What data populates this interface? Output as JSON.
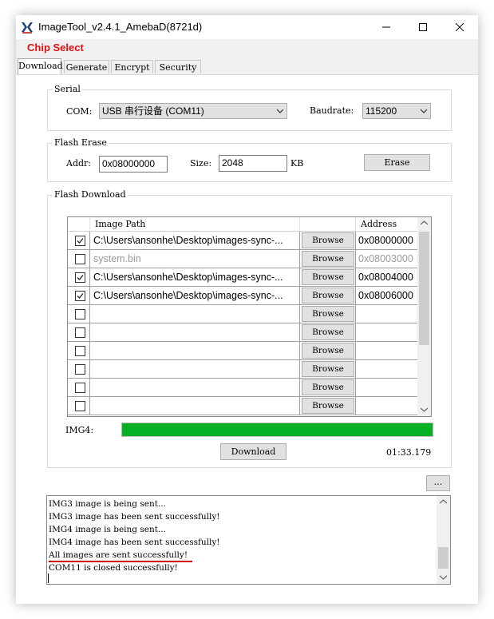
{
  "window": {
    "title": "ImageTool_v2.4.1_AmebaD(8721d)",
    "icon": "realtek-logo-icon"
  },
  "menu": {
    "chip_select": "Chip Select"
  },
  "tabs": [
    {
      "label": "Download",
      "active": true
    },
    {
      "label": "Generate",
      "active": false
    },
    {
      "label": "Encrypt",
      "active": false
    },
    {
      "label": "Security",
      "active": false
    }
  ],
  "serial": {
    "title": "Serial",
    "com_label": "COM:",
    "com_value": "USB 串行设备 (COM11)",
    "baud_label": "Baudrate:",
    "baud_value": "115200"
  },
  "flash_erase": {
    "title": "Flash Erase",
    "addr_label": "Addr:",
    "addr_value": "0x08000000",
    "size_label": "Size:",
    "size_value": "2048",
    "size_unit": "KB",
    "erase_button": "Erase"
  },
  "flash_download": {
    "title": "Flash Download",
    "columns": [
      "Image Path",
      "Address"
    ],
    "browse_label": "Browse",
    "rows": [
      {
        "checked": true,
        "path": "C:\\Users\\ansonhe\\Desktop\\images-sync-...",
        "address": "0x08000000",
        "disabled": false
      },
      {
        "checked": false,
        "path": "system.bin",
        "address": "0x08003000",
        "disabled": true
      },
      {
        "checked": true,
        "path": "C:\\Users\\ansonhe\\Desktop\\images-sync-...",
        "address": "0x08004000",
        "disabled": false
      },
      {
        "checked": true,
        "path": "C:\\Users\\ansonhe\\Desktop\\images-sync-...",
        "address": "0x08006000",
        "disabled": false
      },
      {
        "checked": false,
        "path": "",
        "address": "",
        "disabled": false
      },
      {
        "checked": false,
        "path": "",
        "address": "",
        "disabled": false
      },
      {
        "checked": false,
        "path": "",
        "address": "",
        "disabled": false
      },
      {
        "checked": false,
        "path": "",
        "address": "",
        "disabled": false
      },
      {
        "checked": false,
        "path": "",
        "address": "",
        "disabled": false
      },
      {
        "checked": false,
        "path": "",
        "address": "",
        "disabled": false
      }
    ],
    "progress_label": "IMG4:",
    "progress_fraction": 1.0,
    "download_button": "Download",
    "elapsed": "01:33.179"
  },
  "more_button": "...",
  "log": {
    "lines": [
      "IMG3 image is being sent...",
      "IMG3 image has been sent successfully!",
      "IMG4 image is being sent...",
      "IMG4 image has been sent successfully!",
      "All images are sent successfully!",
      "COM11 is closed successfully!"
    ],
    "highlight_color": "#d40000"
  },
  "colors": {
    "progress": "#06b025",
    "chip_select": "#e01010"
  }
}
